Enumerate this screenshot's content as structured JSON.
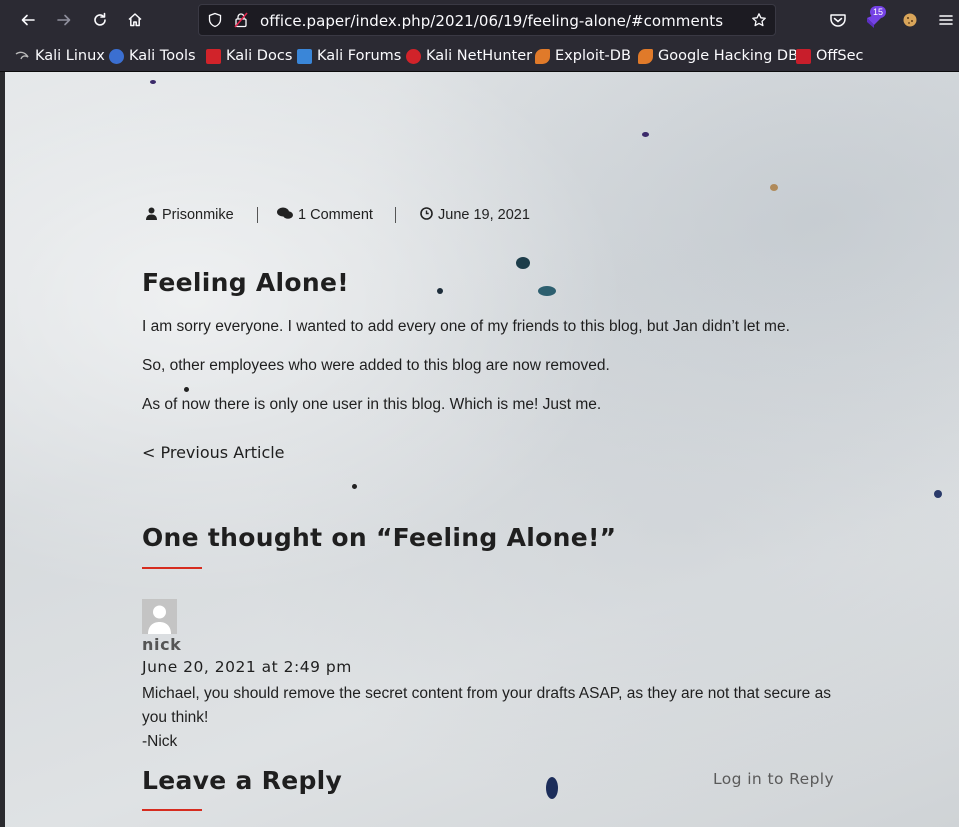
{
  "browser": {
    "url": "office.paper/index.php/2021/06/19/feeling-alone/#comments",
    "extensions_badge": "15",
    "bookmarks": [
      {
        "label": "Kali Linux",
        "icon": "kali-linux-icon"
      },
      {
        "label": "Kali Tools",
        "icon": "kali-tools-icon"
      },
      {
        "label": "Kali Docs",
        "icon": "kali-docs-icon"
      },
      {
        "label": "Kali Forums",
        "icon": "kali-forums-icon"
      },
      {
        "label": "Kali NetHunter",
        "icon": "kali-nethunter-icon"
      },
      {
        "label": "Exploit-DB",
        "icon": "exploit-db-icon"
      },
      {
        "label": "Google Hacking DB",
        "icon": "google-hacking-db-icon"
      },
      {
        "label": "OffSec",
        "icon": "offsec-icon"
      }
    ]
  },
  "post": {
    "author": "Prisonmike",
    "comments_link": "1 Comment",
    "date": "June 19, 2021",
    "title": "Feeling Alone!",
    "paragraphs": [
      "I am sorry everyone. I wanted to add every one of my friends to this blog, but Jan didn’t let me.",
      "So, other employees who were added to this blog are now removed.",
      "As of now there is only one user in this blog. Which is me! Just me."
    ],
    "prev_link": "< Previous Article"
  },
  "comments": {
    "heading": "One thought on “Feeling Alone!”",
    "items": [
      {
        "author": "nick",
        "date": "June 20, 2021 at 2:49 pm",
        "lines": [
          "Michael, you should remove the secret content from your drafts ASAP, as they are not that secure as you think!",
          "-Nick"
        ]
      }
    ]
  },
  "reply": {
    "heading": "Leave a Reply",
    "login_link": "Log in to Reply"
  },
  "colors": {
    "accent_rule": "#d62c1f",
    "chrome_bg": "#2b2a33"
  }
}
